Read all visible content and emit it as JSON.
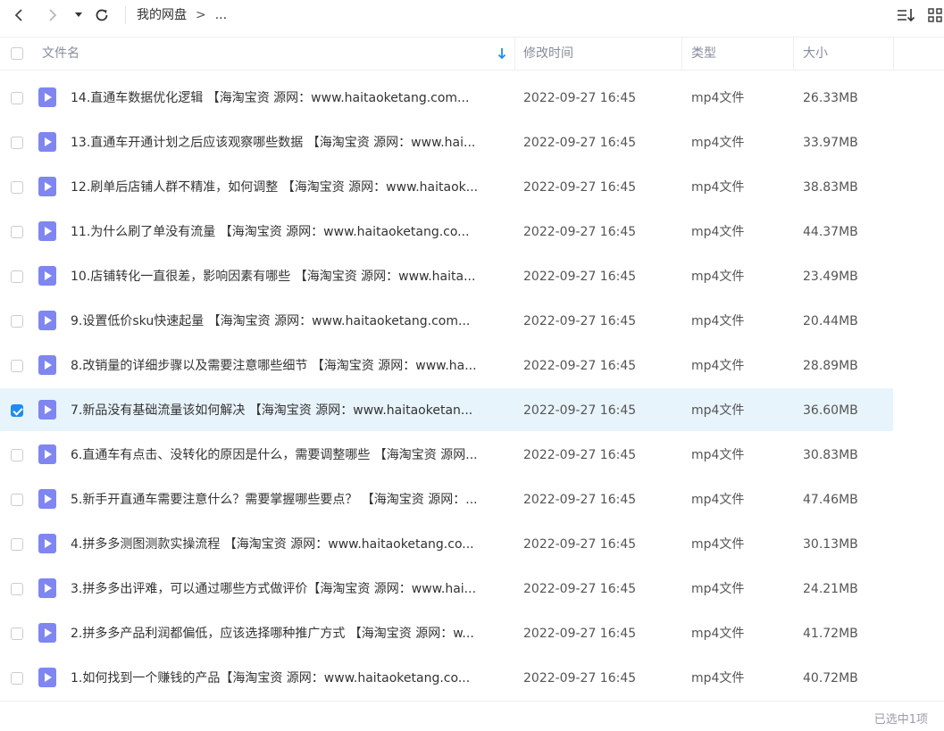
{
  "breadcrumb": {
    "root": "我的网盘",
    "separator": ">",
    "more": "..."
  },
  "columns": {
    "name": "文件名",
    "modified": "修改时间",
    "type": "类型",
    "size": "大小"
  },
  "rows": [
    {
      "name": "14.直通车数据优化逻辑 【海淘宝资 源网：www.haitaoketang.com...",
      "modified": "2022-09-27 16:45",
      "type": "mp4文件",
      "size": "26.33MB",
      "selected": false
    },
    {
      "name": "13.直通车开通计划之后应该观察哪些数据 【海淘宝资 源网：www.hai...",
      "modified": "2022-09-27 16:45",
      "type": "mp4文件",
      "size": "33.97MB",
      "selected": false
    },
    {
      "name": "12.刷单后店铺人群不精准，如何调整 【海淘宝资 源网：www.haitaok...",
      "modified": "2022-09-27 16:45",
      "type": "mp4文件",
      "size": "38.83MB",
      "selected": false
    },
    {
      "name": "11.为什么刷了单没有流量 【海淘宝资 源网：www.haitaoketang.co...",
      "modified": "2022-09-27 16:45",
      "type": "mp4文件",
      "size": "44.37MB",
      "selected": false
    },
    {
      "name": "10.店铺转化一直很差，影响因素有哪些 【海淘宝资 源网：www.haita...",
      "modified": "2022-09-27 16:45",
      "type": "mp4文件",
      "size": "23.49MB",
      "selected": false
    },
    {
      "name": "9.设置低价sku快速起量 【海淘宝资 源网：www.haitaoketang.com...",
      "modified": "2022-09-27 16:45",
      "type": "mp4文件",
      "size": "20.44MB",
      "selected": false
    },
    {
      "name": "8.改销量的详细步骤以及需要注意哪些细节 【海淘宝资 源网：www.ha...",
      "modified": "2022-09-27 16:45",
      "type": "mp4文件",
      "size": "28.89MB",
      "selected": false
    },
    {
      "name": "7.新品没有基础流量该如何解决 【海淘宝资 源网：www.haitaoketan...",
      "modified": "2022-09-27 16:45",
      "type": "mp4文件",
      "size": "36.60MB",
      "selected": true
    },
    {
      "name": "6.直通车有点击、没转化的原因是什么，需要调整哪些 【海淘宝资 源网...",
      "modified": "2022-09-27 16:45",
      "type": "mp4文件",
      "size": "30.83MB",
      "selected": false
    },
    {
      "name": "5.新手开直通车需要注意什么？需要掌握哪些要点？ 【海淘宝资 源网：...",
      "modified": "2022-09-27 16:45",
      "type": "mp4文件",
      "size": "47.46MB",
      "selected": false
    },
    {
      "name": "4.拼多多测图测款实操流程 【海淘宝资 源网：www.haitaoketang.co...",
      "modified": "2022-09-27 16:45",
      "type": "mp4文件",
      "size": "30.13MB",
      "selected": false
    },
    {
      "name": "3.拼多多出评难，可以通过哪些方式做评价【海淘宝资 源网：www.hai...",
      "modified": "2022-09-27 16:45",
      "type": "mp4文件",
      "size": "24.21MB",
      "selected": false
    },
    {
      "name": "2.拼多多产品利润都偏低，应该选择哪种推广方式 【海淘宝资 源网：w...",
      "modified": "2022-09-27 16:45",
      "type": "mp4文件",
      "size": "41.72MB",
      "selected": false
    },
    {
      "name": "1.如何找到一个赚钱的产品【海淘宝资 源网：www.haitaoketang.co...",
      "modified": "2022-09-27 16:45",
      "type": "mp4文件",
      "size": "40.72MB",
      "selected": false
    }
  ],
  "status": {
    "selection": "已选中1项"
  },
  "colors": {
    "accent": "#1e8cf0",
    "selected_row": "#e8f4fc",
    "video_icon": "#7f86f0"
  }
}
